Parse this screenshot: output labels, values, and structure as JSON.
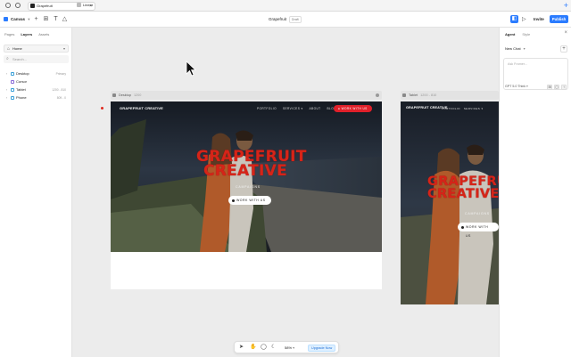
{
  "titlebar": {
    "tabs": [
      {
        "label": "Grapefruit"
      },
      {
        "label": "Linear"
      }
    ]
  },
  "toolbar": {
    "canvas_label": "Canvas",
    "doc_title": "Grapefruit",
    "doc_badge": "Draft",
    "invite_label": "Invite",
    "publish_label": "Publish"
  },
  "left_panel": {
    "tabs": [
      "Pages",
      "Layers",
      "Assets"
    ],
    "active_tab": "Layers",
    "page_select": "Home",
    "search_placeholder": "Search...",
    "layers": [
      {
        "name": "Desktop",
        "meta": "Primary"
      },
      {
        "name": "Cursor",
        "meta": ""
      },
      {
        "name": "Tablet",
        "meta": "1200 - 810"
      },
      {
        "name": "Phone",
        "meta": "809 - 0"
      }
    ]
  },
  "canvas": {
    "frames": [
      {
        "name": "Desktop",
        "dim": "1200"
      },
      {
        "name": "Tablet",
        "dim": "1200 - 810"
      }
    ],
    "site": {
      "brand": "GRAPEFRUIT CREATIVE",
      "nav": [
        "PORTFOLIO",
        "SERVICES",
        "ABOUT",
        "BLOG"
      ],
      "nav_chevron": "▾",
      "nav_cta": "WORK WITH US",
      "headline_line1": "GRAPEFRUIT",
      "headline_line2": "CREATIVE",
      "tagline": "CAMPAIGNS",
      "hero_button": "WORK WITH US"
    }
  },
  "right_panel": {
    "tabs": [
      "Agent",
      "Style"
    ],
    "active_tab": "Agent",
    "chat_label": "New Chat",
    "chat_placeholder": "Ask Framer...",
    "model": "GPT 5.0 Think"
  },
  "bottom_bar": {
    "zoom": "58%",
    "upgrade_label": "Upgrade Now"
  },
  "colors": {
    "accent": "#2b7cff",
    "headline": "#d62418",
    "nav_cta": "#e0202a"
  }
}
